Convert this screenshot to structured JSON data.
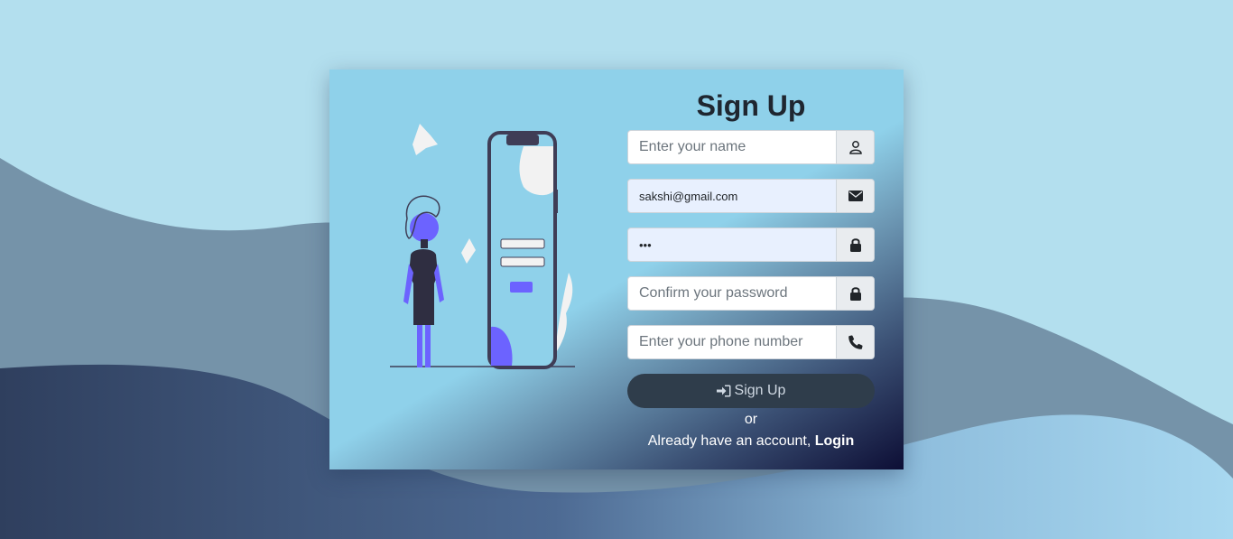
{
  "form": {
    "title": "Sign Up",
    "name": {
      "placeholder": "Enter your name",
      "value": "",
      "icon": "user-icon"
    },
    "email": {
      "placeholder": "",
      "value": "sakshi@gmail.com",
      "icon": "envelope-icon"
    },
    "password": {
      "placeholder": "",
      "value": "•••",
      "icon": "lock-icon"
    },
    "confirm_password": {
      "placeholder": "Confirm your password",
      "value": "",
      "icon": "lock-icon"
    },
    "phone": {
      "placeholder": "Enter your phone number",
      "value": "",
      "icon": "phone-icon"
    },
    "submit_label": "Sign Up",
    "submit_icon": "sign-in-icon",
    "or_text": "or",
    "login_prompt": "Already have an account,",
    "login_link": "Login"
  },
  "colors": {
    "background": "#b3dfee",
    "card_light": "#8fd1ea",
    "card_dark": "#0d0e35",
    "button": "#2f3d4b",
    "accent_purple": "#6c63ff"
  }
}
